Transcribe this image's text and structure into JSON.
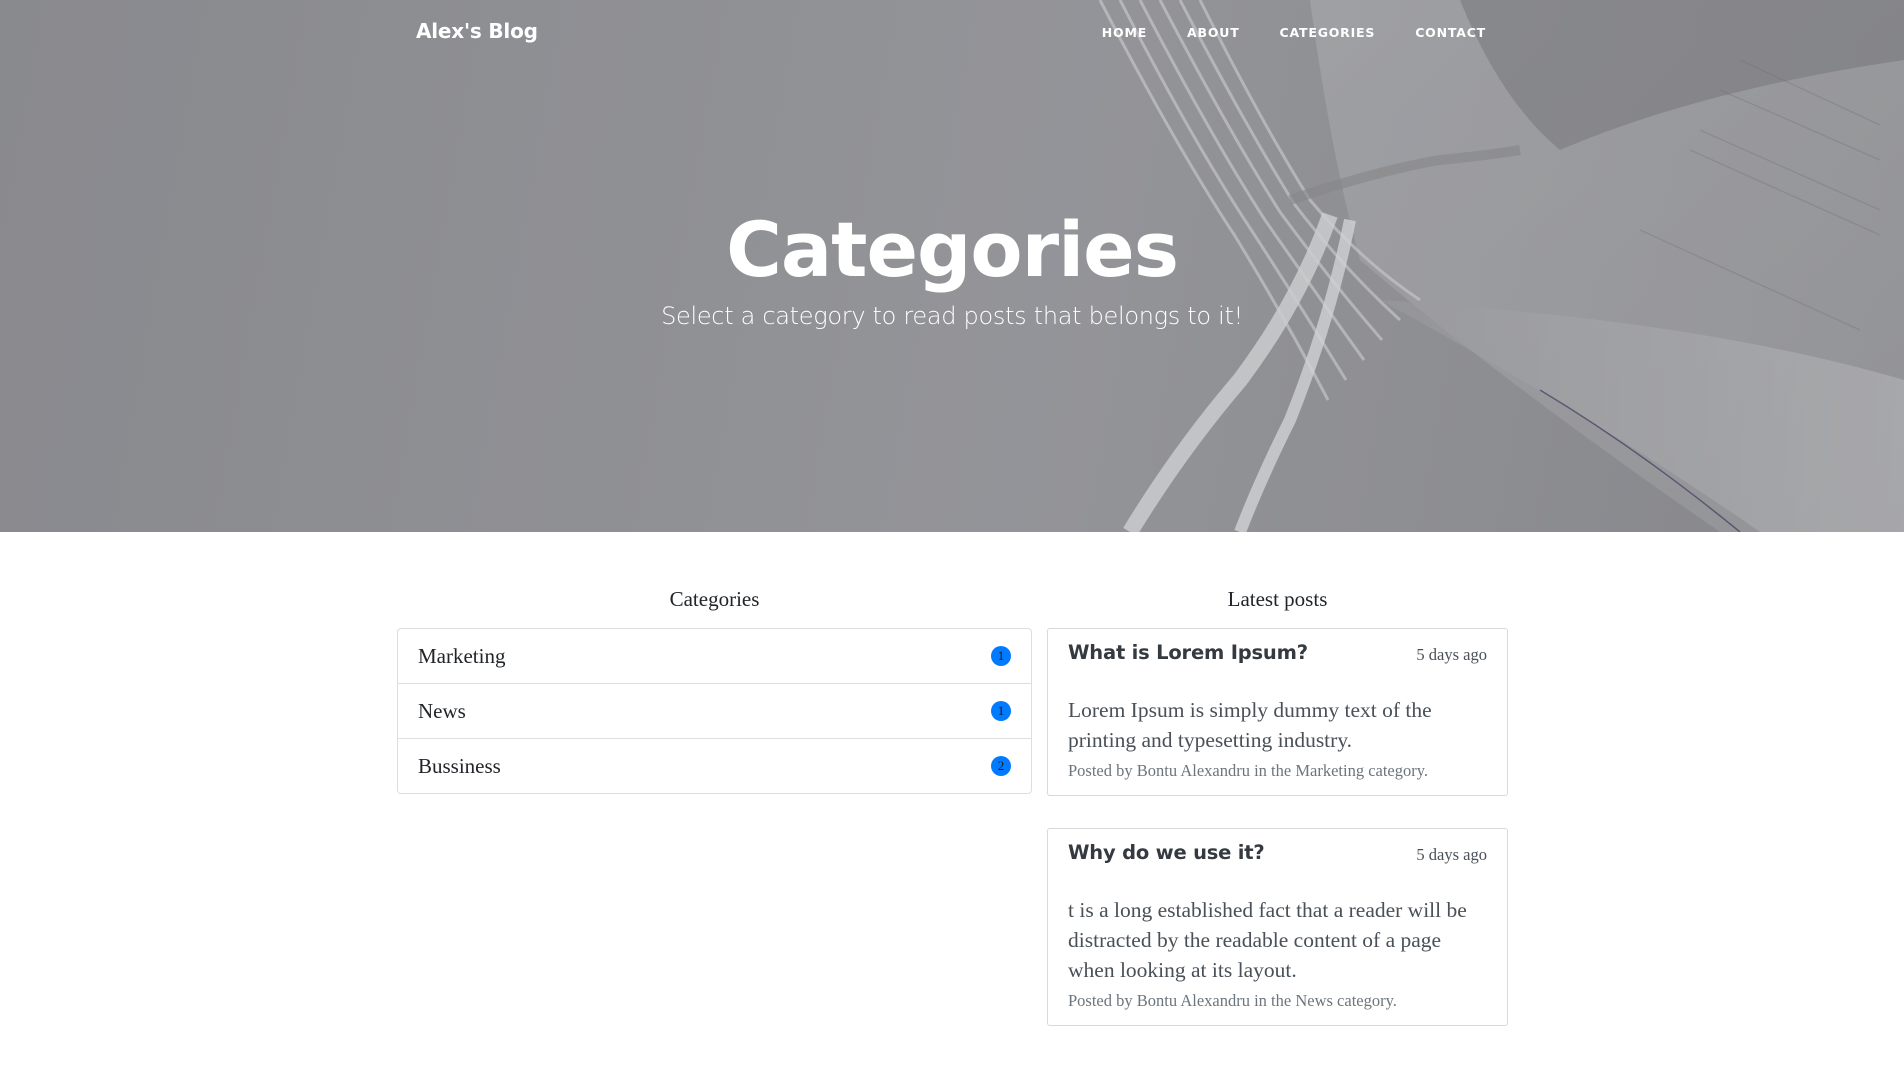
{
  "navbar": {
    "brand": "Alex's Blog",
    "links": [
      {
        "label": "HOME"
      },
      {
        "label": "ABOUT"
      },
      {
        "label": "CATEGORIES"
      },
      {
        "label": "CONTACT"
      }
    ]
  },
  "hero": {
    "heading": "Categories",
    "subheading": "Select a category to read posts that belongs to it!"
  },
  "categories": {
    "title": "Categories",
    "items": [
      {
        "name": "Marketing",
        "count": "1"
      },
      {
        "name": "News",
        "count": "1"
      },
      {
        "name": "Bussiness",
        "count": "2"
      }
    ],
    "badge_color": "#007bff"
  },
  "latest_posts": {
    "title": "Latest posts",
    "posts": [
      {
        "title": "What is Lorem Ipsum?",
        "time": "5 days ago",
        "body": "Lorem Ipsum is simply dummy text of the printing and typesetting industry.",
        "meta_prefix": "Posted by ",
        "author": "Bontu Alexandru",
        "meta_middle": " in the ",
        "category": "Marketing",
        "meta_suffix": " category."
      },
      {
        "title": "Why do we use it?",
        "time": "5 days ago",
        "body": "t is a long established fact that a reader will be distracted by the readable content of a page when looking at its layout.",
        "meta_prefix": "Posted by ",
        "author": "Bontu Alexandru",
        "meta_middle": " in the ",
        "category": "News",
        "meta_suffix": " category."
      }
    ]
  }
}
